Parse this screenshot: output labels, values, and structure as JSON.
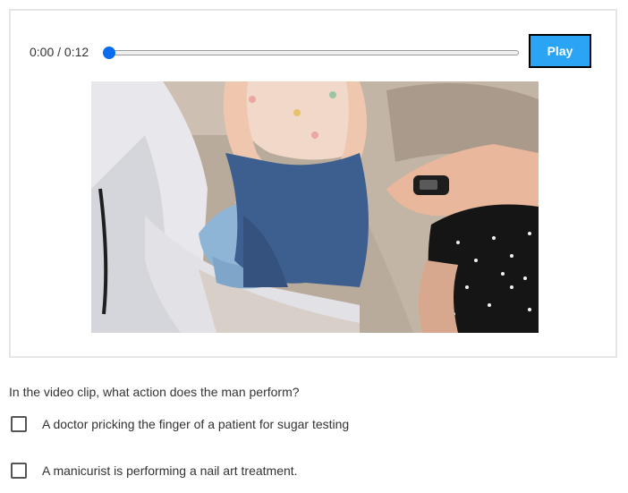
{
  "player": {
    "time_display": "0:00 / 0:12",
    "progress": 0,
    "play_label": "Play"
  },
  "question": {
    "text": "In the video clip, what action does the man perform?",
    "options": [
      {
        "label": "A doctor pricking the finger of a patient for sugar testing",
        "checked": false
      },
      {
        "label": "A manicurist is performing a nail art treatment.",
        "checked": false
      }
    ]
  },
  "colors": {
    "play_button": "#2aa4f4",
    "seek_thumb": "#0b6cf0",
    "border": "#e6e6e6"
  },
  "icons": {
    "checkbox": "square-outline"
  }
}
